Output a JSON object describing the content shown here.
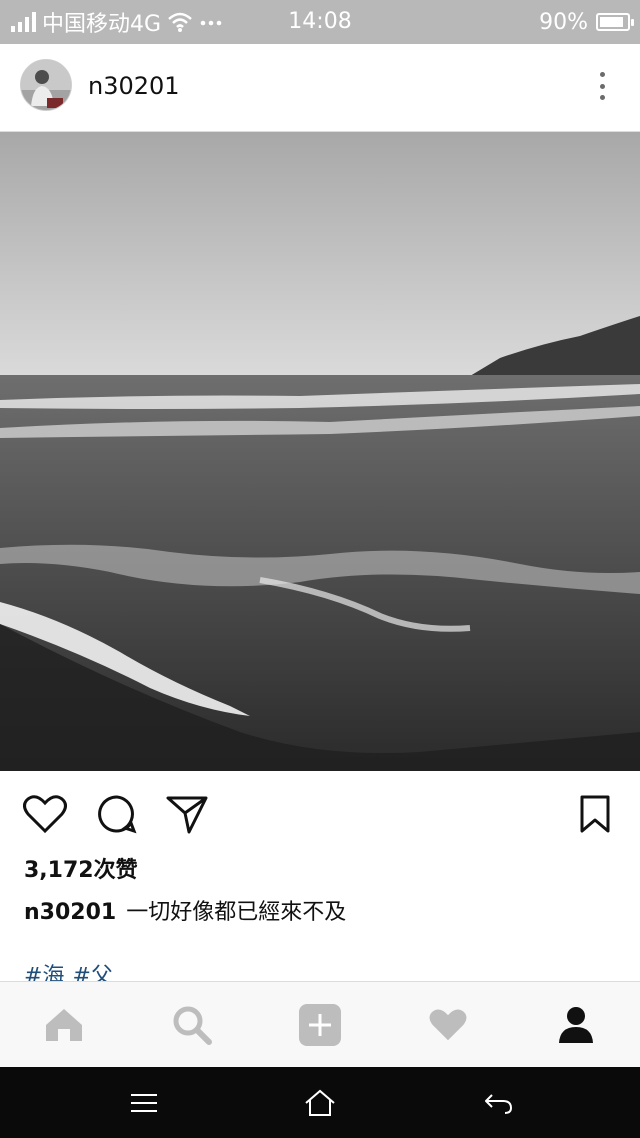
{
  "status_bar": {
    "carrier": "中国移动4G",
    "time": "14:08",
    "battery": "90%",
    "battery_level": 0.9,
    "icons": [
      "signal-icon",
      "wifi-icon",
      "more-dots-icon",
      "battery-icon"
    ]
  },
  "post": {
    "username": "n30201",
    "likes": "3,172次赞",
    "caption_user": "n30201",
    "caption_text": "一切好像都已經來不及",
    "hashtags": [
      "#海",
      "#父"
    ]
  },
  "actions": {
    "icons": [
      "heart-icon",
      "comment-icon",
      "share-icon",
      "bookmark-icon"
    ]
  },
  "tab_bar": {
    "icons": [
      "home-icon",
      "search-icon",
      "add-icon",
      "heart-icon",
      "profile-icon"
    ],
    "active": "profile-icon"
  },
  "nav_bar": {
    "icons": [
      "menu-icon",
      "home-icon",
      "back-icon"
    ]
  },
  "colors": {
    "status_bar_bg": "#b8b8b8",
    "hashtag": "#1f4e79",
    "tab_inactive": "#bdbdbd",
    "tab_active": "#111111",
    "nav_bar_bg": "#0a0a0a"
  }
}
